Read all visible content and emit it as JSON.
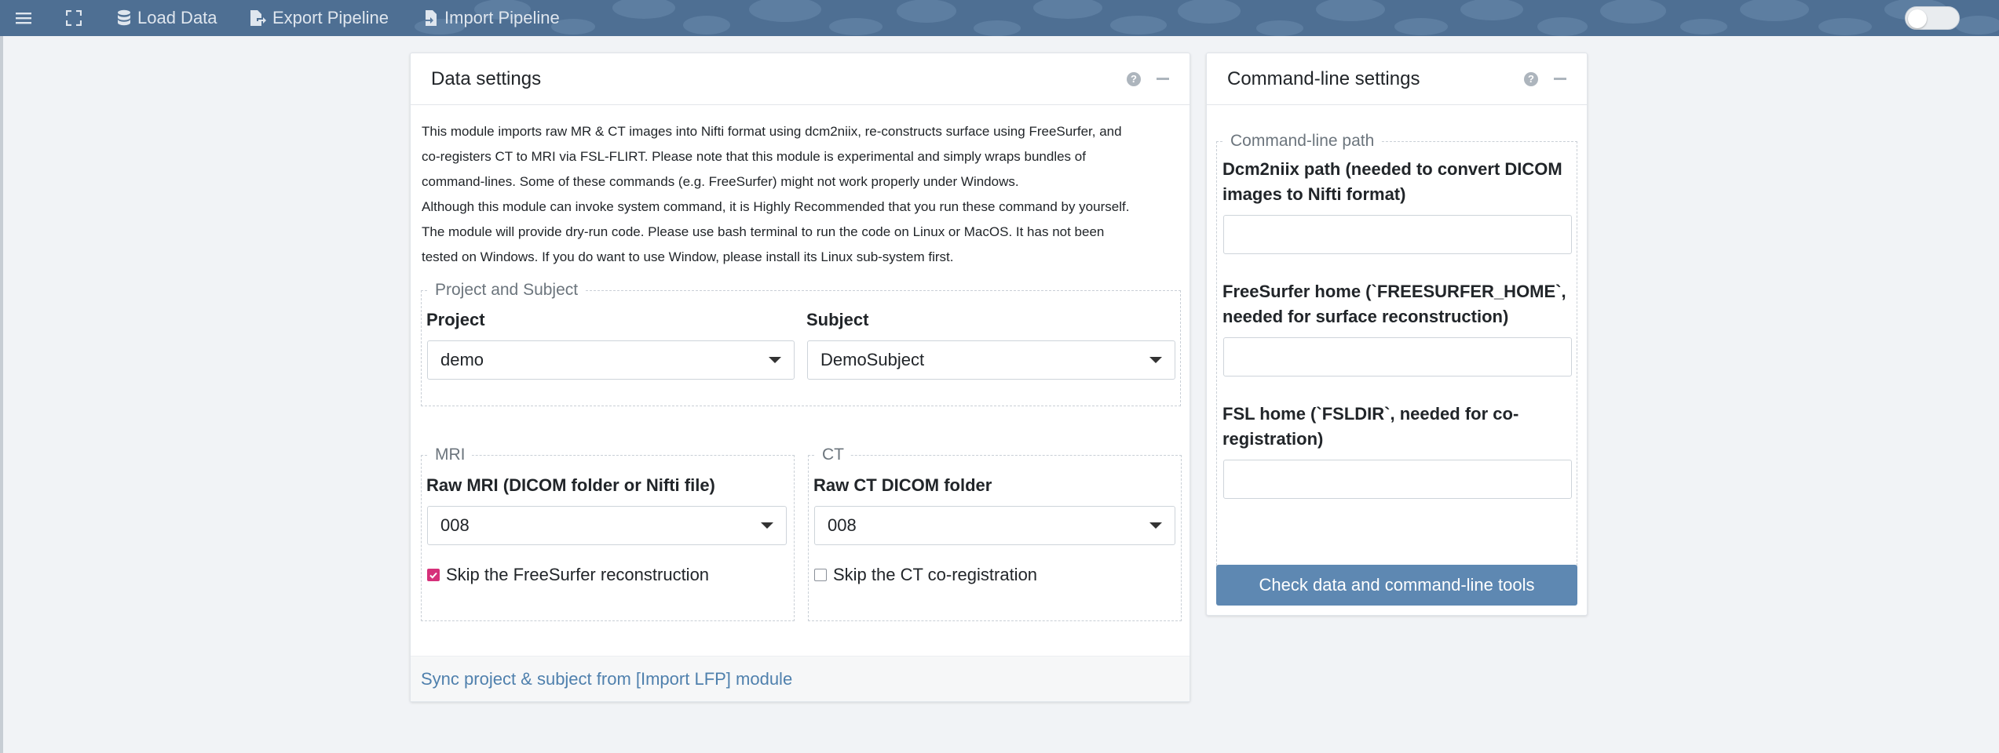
{
  "navbar": {
    "items": [
      {
        "label": "",
        "icon": "hamburger-icon"
      },
      {
        "label": "",
        "icon": "fullscreen-icon"
      },
      {
        "label": "Load Data",
        "icon": "database-icon"
      },
      {
        "label": "Export Pipeline",
        "icon": "export-file-icon"
      },
      {
        "label": "Import Pipeline",
        "icon": "import-file-icon"
      }
    ],
    "toggle_on": false
  },
  "data_settings": {
    "title": "Data settings",
    "description": [
      "This module imports raw MR & CT images into Nifti format using dcm2niix, re-constructs surface using FreeSurfer, and",
      "co-registers CT to MRI via FSL-FLIRT. Please note that this module is experimental and simply wraps bundles of",
      "command-lines. Some of these commands (e.g. FreeSurfer) might not work properly under Windows.",
      "Although this module can invoke system command, it is Highly Recommended that you run these command by yourself.",
      "The module will provide dry-run code. Please use bash terminal to run the code on Linux or MacOS. It has not been",
      "tested on Windows. If you do want to use Window, please install its Linux sub-system first."
    ],
    "project_subject": {
      "legend": "Project and Subject",
      "project_label": "Project",
      "project_value": "demo",
      "subject_label": "Subject",
      "subject_value": "DemoSubject"
    },
    "mri": {
      "legend": "MRI",
      "label": "Raw MRI (DICOM folder or Nifti file)",
      "value": "008",
      "checkbox_label": "Skip the FreeSurfer reconstruction",
      "checked": true
    },
    "ct": {
      "legend": "CT",
      "label": "Raw CT DICOM folder",
      "value": "008",
      "checkbox_label": "Skip the CT co-registration",
      "checked": false
    },
    "footer_link": "Sync project & subject from [Import LFP] module"
  },
  "cmd_settings": {
    "title": "Command-line settings",
    "legend": "Command-line path",
    "dcm2niix_label": [
      "Dcm2niix path (needed to convert DICOM",
      "images to Nifti format)"
    ],
    "dcm2niix_value": "",
    "freesurfer_label": [
      "FreeSurfer home (`FREESURFER_HOME`,",
      "needed for surface reconstruction)"
    ],
    "freesurfer_value": "",
    "fsl_label": [
      "FSL home (`FSLDIR`, needed for co-",
      "registration)"
    ],
    "fsl_value": "",
    "button_label": "Check data and command-line tools"
  },
  "colors": {
    "navbar": "#4e6f93",
    "accent": "#5e88b2",
    "checkbox": "#d6307a",
    "link": "#4f80ad"
  }
}
